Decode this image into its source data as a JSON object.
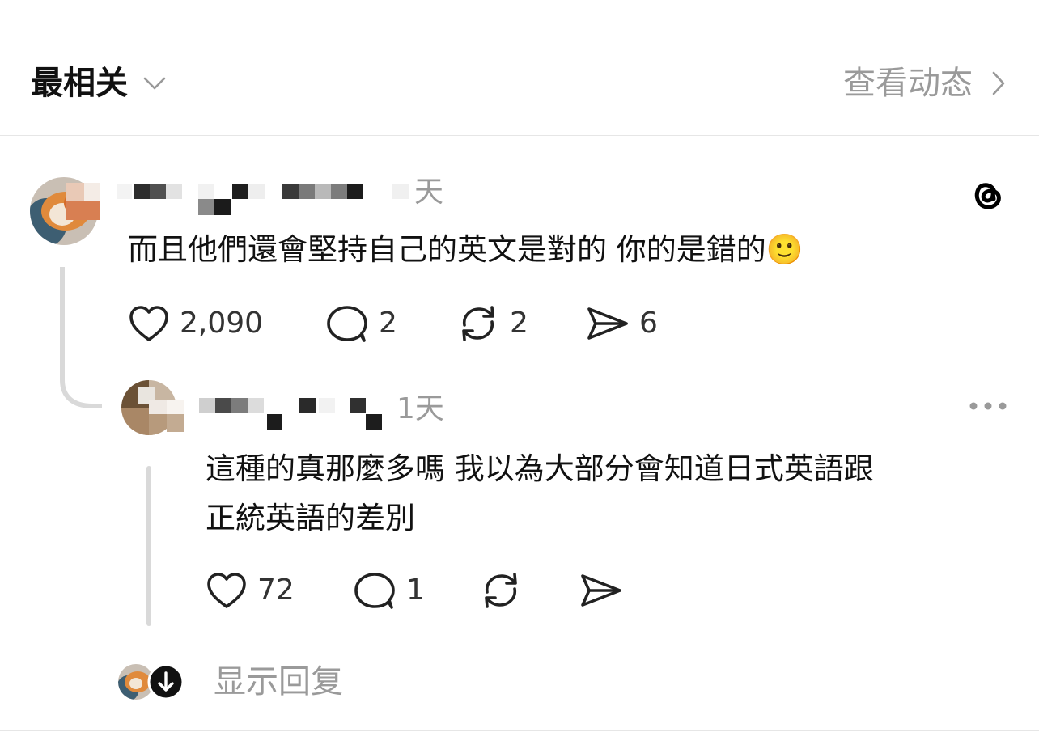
{
  "header": {
    "sort_label": "最相关",
    "activity_label": "查看动态"
  },
  "comments": [
    {
      "time": "天",
      "text": "而且他們還會堅持自己的英文是對的 你的是錯的🙂",
      "likes": "2,090",
      "replies": "2",
      "reposts": "2",
      "shares": "6"
    },
    {
      "time": "1天",
      "text_line1": "這種的真那麼多嗎 我以為大部分會知道日式英語跟",
      "text_line2": "正統英語的差別",
      "likes": "72",
      "replies": "1"
    }
  ],
  "footer": {
    "show_replies_label": "显示回复"
  },
  "icons": {
    "threads": "threads-logo-icon",
    "more": "more-dots-icon",
    "like": "heart-icon",
    "reply": "comment-bubble-icon",
    "repost": "repost-icon",
    "share": "send-icon",
    "expand": "arrow-down-icon"
  },
  "colors": {
    "text": "#111111",
    "muted": "#9a9a9a",
    "divider": "#e6e6e6",
    "thread_line": "#d9d9d9"
  }
}
